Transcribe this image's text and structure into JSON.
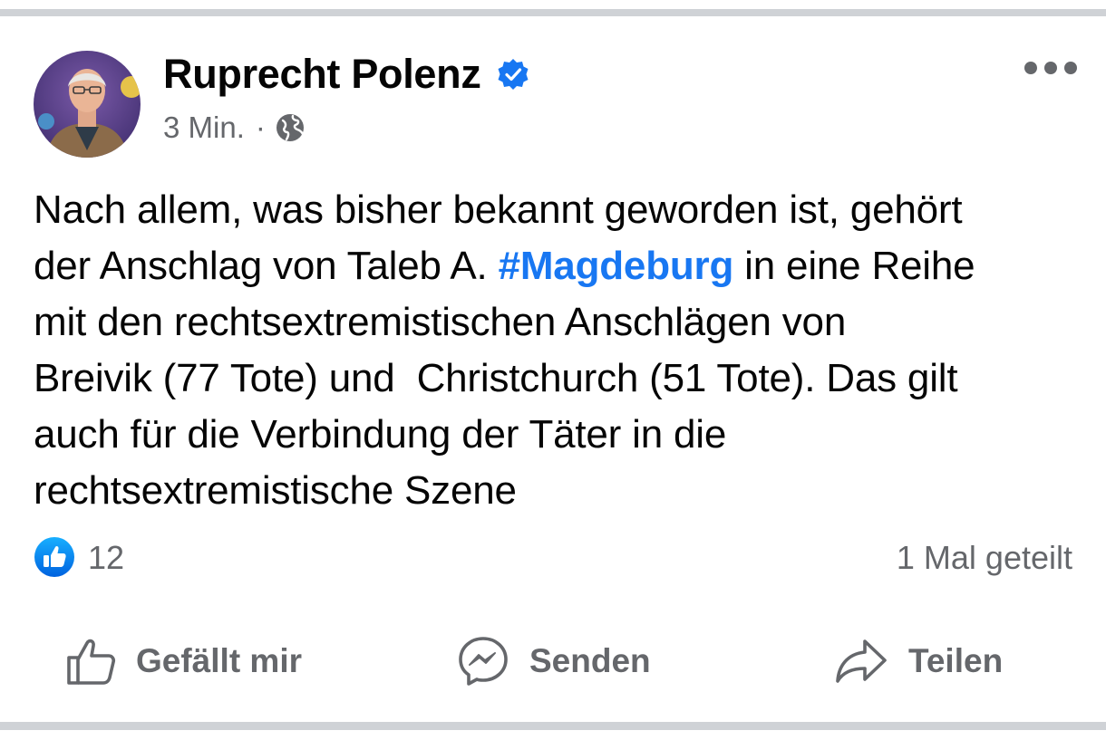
{
  "post": {
    "author": {
      "name": "Ruprecht Polenz",
      "verified": true,
      "avatar": "author-avatar-photo"
    },
    "meta": {
      "time": "3 Min.",
      "separator": "·",
      "audience_icon": "globe-icon"
    },
    "more_icon": "more-options-icon",
    "text": {
      "line1": "Nach allem, was bisher bekannt geworden ist, gehört",
      "line2_before": "der Anschlag von Taleb A. ",
      "hashtag": "#Magdeburg",
      "line2_after": " in eine Reihe",
      "line3": "mit den rechtsextremistischen Anschlägen von",
      "line4": "Breivik (77 Tote) und  Christchurch (51 Tote). Das gilt",
      "line5": "auch für die Verbindung der Täter in die",
      "line6": "rechtsextremistische Szene"
    },
    "stats": {
      "like_icon": "like-reaction-icon",
      "likes": "12",
      "shares": "1 Mal geteilt"
    },
    "actions": {
      "like_label": "Gefällt mir",
      "send_label": "Senden",
      "share_label": "Teilen"
    }
  },
  "colors": {
    "accent": "#1877f2",
    "text": "#050505",
    "secondary_text": "#65676b",
    "divider": "#cfd2d6"
  }
}
